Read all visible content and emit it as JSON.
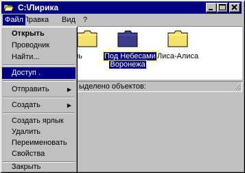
{
  "window": {
    "title": "C:\\Лирика",
    "icon": "open-folder-icon"
  },
  "menubar": {
    "file": "Файл",
    "edit": "Правка",
    "view": "Вид",
    "help": "?"
  },
  "files": [
    {
      "name": "День",
      "icon": "folder-icon"
    },
    {
      "name": "Под Небесами Воронежа",
      "line1": "Под Небесами",
      "line2": "Воронежа",
      "icon": "folder-icon",
      "selected": true
    },
    {
      "name": "Лиса-Алиса",
      "icon": "folder-icon"
    }
  ],
  "statusbar": {
    "text": "ыделено объектов:"
  },
  "file_menu": {
    "open": "Открыть",
    "explorer": "Проводник",
    "find": "Найти...",
    "sharing": "Доступ .",
    "send_to": "Отправить",
    "new": "Создать",
    "create_shortcut": "Создать ярлык",
    "delete": "Удалить",
    "rename": "Переименовать",
    "properties": "Свойства",
    "close": "Закрыть"
  },
  "colors": {
    "titlebar": "#000080",
    "selection": "#000080",
    "folder": "#f4e26d",
    "face": "#c0c0c0"
  }
}
